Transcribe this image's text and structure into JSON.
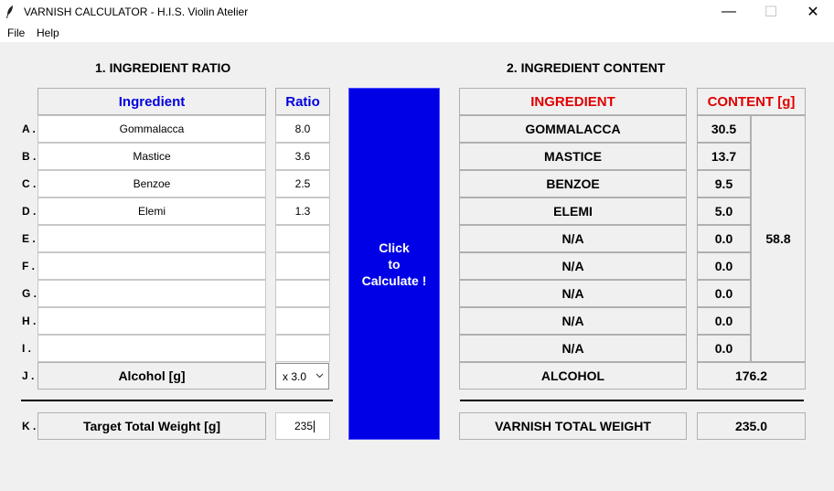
{
  "window": {
    "title": "VARNISH CALCULATOR - H.I.S. Violin Atelier",
    "minimize_glyph": "—",
    "maximize_glyph": "☐",
    "close_glyph": "✕"
  },
  "menu": {
    "file": "File",
    "help": "Help"
  },
  "left": {
    "section_title": "1. INGREDIENT RATIO",
    "header_ingredient": "Ingredient",
    "header_ratio": "Ratio",
    "rows": [
      {
        "label": "A .",
        "ingredient": "Gommalacca",
        "ratio": "8.0"
      },
      {
        "label": "B .",
        "ingredient": "Mastice",
        "ratio": "3.6"
      },
      {
        "label": "C .",
        "ingredient": "Benzoe",
        "ratio": "2.5"
      },
      {
        "label": "D .",
        "ingredient": "Elemi",
        "ratio": "1.3"
      },
      {
        "label": "E .",
        "ingredient": "",
        "ratio": ""
      },
      {
        "label": "F .",
        "ingredient": "",
        "ratio": ""
      },
      {
        "label": "G .",
        "ingredient": "",
        "ratio": ""
      },
      {
        "label": "H .",
        "ingredient": "",
        "ratio": ""
      },
      {
        "label": "I .",
        "ingredient": "",
        "ratio": ""
      }
    ],
    "alcohol_label": "J .",
    "alcohol_name": "Alcohol [g]",
    "alcohol_multiplier": "x 3.0",
    "target_label": "K .",
    "target_name": "Target Total Weight [g]",
    "target_value": "235"
  },
  "calculate_button": "Click\nto\nCalculate !",
  "right": {
    "section_title": "2. INGREDIENT CONTENT",
    "header_ingredient": "INGREDIENT",
    "header_content": "CONTENT [g]",
    "rows": [
      {
        "ingredient": "GOMMALACCA",
        "content": "30.5"
      },
      {
        "ingredient": "MASTICE",
        "content": "13.7"
      },
      {
        "ingredient": "BENZOE",
        "content": "9.5"
      },
      {
        "ingredient": "ELEMI",
        "content": "5.0"
      },
      {
        "ingredient": "N/A",
        "content": "0.0"
      },
      {
        "ingredient": "N/A",
        "content": "0.0"
      },
      {
        "ingredient": "N/A",
        "content": "0.0"
      },
      {
        "ingredient": "N/A",
        "content": "0.0"
      },
      {
        "ingredient": "N/A",
        "content": "0.0"
      }
    ],
    "subtotal": "58.8",
    "alcohol_name": "ALCOHOL",
    "alcohol_value": "176.2",
    "total_name": "VARNISH TOTAL WEIGHT",
    "total_value": "235.0"
  },
  "colors": {
    "button_blue": "#0000e6",
    "header_blue": "#0000e0",
    "header_red": "#e00000",
    "background": "#f0f0f0"
  }
}
